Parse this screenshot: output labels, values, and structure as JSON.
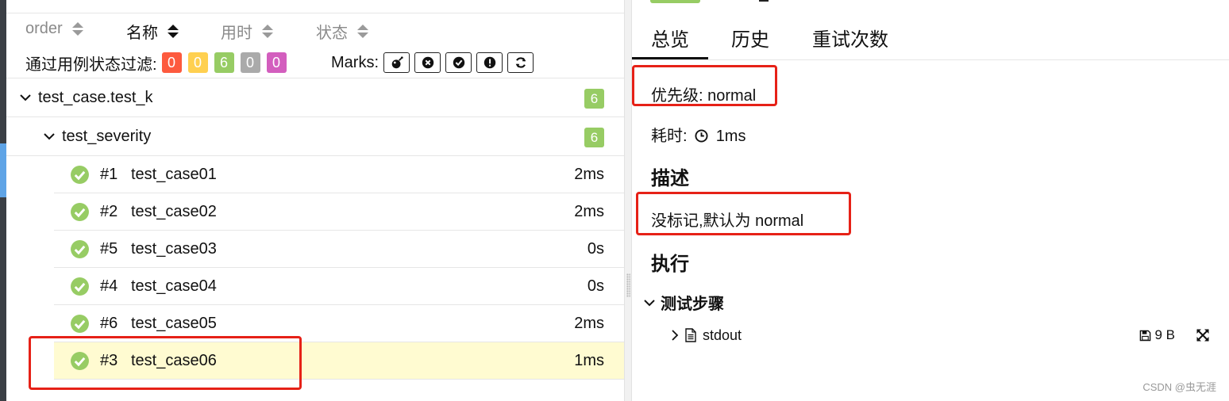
{
  "sort": {
    "items": [
      {
        "label": "order",
        "active": false
      },
      {
        "label": "名称",
        "active": true
      },
      {
        "label": "用时",
        "active": false
      },
      {
        "label": "状态",
        "active": false
      }
    ]
  },
  "filter": {
    "label": "通过用例状态过滤:",
    "badges": [
      {
        "value": "0",
        "color": "#fd5a3e"
      },
      {
        "value": "0",
        "color": "#ffd050"
      },
      {
        "value": "6",
        "color": "#97cc64"
      },
      {
        "value": "0",
        "color": "#aaaaaa"
      },
      {
        "value": "0",
        "color": "#d35ebe"
      }
    ]
  },
  "marks": {
    "label": "Marks:",
    "icons": [
      "bomb-icon",
      "times-circle-icon",
      "check-circle-icon",
      "exclamation-circle-icon",
      "refresh-icon"
    ]
  },
  "tree": {
    "suite": {
      "name": "test_case.test_k",
      "count": "6"
    },
    "module": {
      "name": "test_severity",
      "count": "6"
    },
    "cases": [
      {
        "num": "#1",
        "name": "test_case01",
        "time": "2ms"
      },
      {
        "num": "#2",
        "name": "test_case02",
        "time": "2ms"
      },
      {
        "num": "#5",
        "name": "test_case03",
        "time": "0s"
      },
      {
        "num": "#4",
        "name": "test_case04",
        "time": "0s"
      },
      {
        "num": "#6",
        "name": "test_case05",
        "time": "2ms"
      },
      {
        "num": "#3",
        "name": "test_case06",
        "time": "1ms"
      }
    ]
  },
  "detail": {
    "tabs": [
      "总览",
      "历史",
      "重试次数"
    ],
    "severity": "优先级: normal",
    "duration_label": "耗时:",
    "duration": "1ms",
    "desc_heading": "描述",
    "description": "没标记,默认为 normal",
    "exec_heading": "执行",
    "steps_label": "测试步骤",
    "attachment": {
      "name": "stdout",
      "size": "9 B"
    }
  },
  "footer": "CSDN @虫无涯",
  "colors": {
    "passed": "#97cc64",
    "selected_row": "#fffbd1",
    "highlight": "#e62117"
  }
}
